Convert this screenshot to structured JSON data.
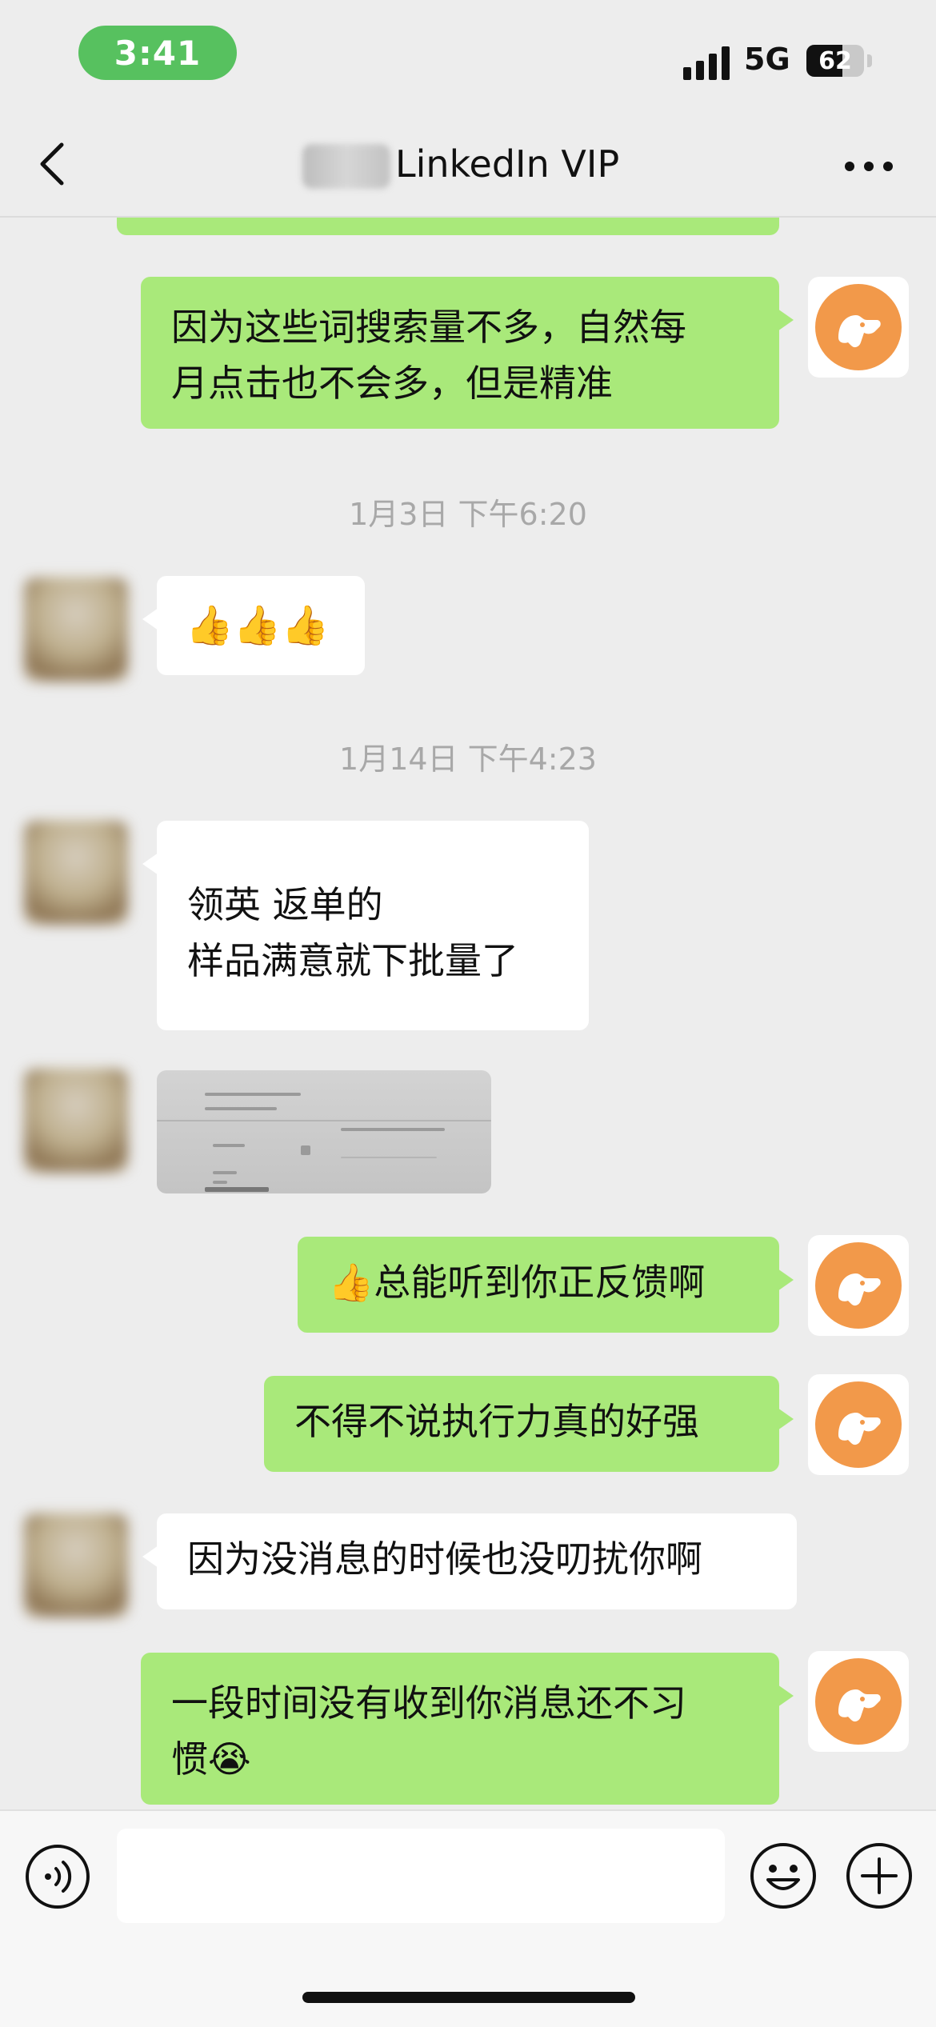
{
  "status_bar": {
    "time": "3:41",
    "network": "5G",
    "battery_level": "62",
    "battery_fraction": 0.62
  },
  "nav": {
    "title": "LinkedIn VIP",
    "back_icon": "chevron-left-icon",
    "more_icon": "ellipsis-icon"
  },
  "messages": [
    {
      "side": "out",
      "text": "因为这些词搜索量不多，自然每\n月点击也不会多，但是精准"
    },
    {
      "side": "time",
      "text": "1月3日 下午6:20"
    },
    {
      "side": "in",
      "text": "👍👍👍"
    },
    {
      "side": "time",
      "text": "1月14日 下午4:23"
    },
    {
      "side": "in",
      "text": "\n领英 返单的\n样品满意就下批量了"
    },
    {
      "side": "in",
      "type": "image"
    },
    {
      "side": "out",
      "text": "👍总能听到你正反馈啊"
    },
    {
      "side": "out",
      "text": "不得不说执行力真的好强"
    },
    {
      "side": "in",
      "text": "因为没消息的时候也没叨扰你啊"
    },
    {
      "side": "out",
      "text": "一段时间没有收到你消息还不习\n惯😭"
    }
  ],
  "input_bar": {
    "voice_icon": "voice-icon",
    "emoji_icon": "smiley-icon",
    "plus_icon": "plus-icon",
    "value": ""
  },
  "colors": {
    "out_bubble": "#a9e97a",
    "in_bubble": "#ffffff",
    "background": "#ededed",
    "time_pill": "#57c15f",
    "avatar_orange": "#f2994a"
  }
}
